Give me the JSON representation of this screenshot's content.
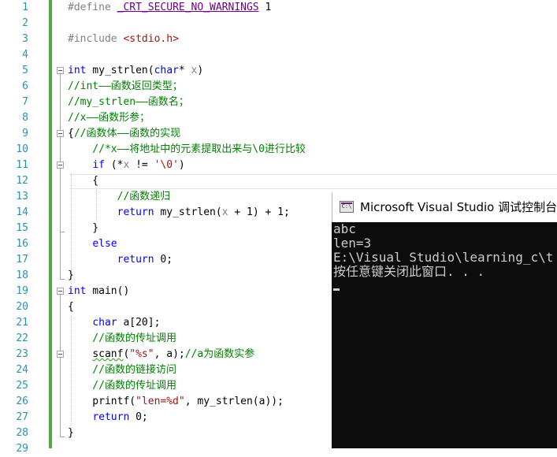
{
  "editor": {
    "line_numbers": [
      "1",
      "2",
      "3",
      "4",
      "5",
      "6",
      "7",
      "8",
      "9",
      "10",
      "11",
      "12",
      "13",
      "14",
      "15",
      "16",
      "17",
      "18",
      "19",
      "20",
      "21",
      "22",
      "23",
      "24",
      "25",
      "26",
      "27",
      "28",
      "29"
    ],
    "lines": [
      [
        {
          "t": "#define ",
          "c": "pp"
        },
        {
          "t": "_CRT_SECURE_NO_WARNINGS",
          "c": "mac",
          "u": "purple"
        },
        {
          "t": " 1",
          "c": "num"
        }
      ],
      [],
      [
        {
          "t": "#include ",
          "c": "pp"
        },
        {
          "t": "<stdio.h>",
          "c": "inc"
        }
      ],
      [],
      [
        {
          "t": "int",
          "c": "kw"
        },
        {
          "t": " my_strlen(",
          "c": ""
        },
        {
          "t": "char",
          "c": "kw"
        },
        {
          "t": "* ",
          "c": ""
        },
        {
          "t": "x",
          "c": "prm"
        },
        {
          "t": ")",
          "c": ""
        }
      ],
      [
        {
          "t": "//int——函数返回类型；",
          "c": "cm"
        }
      ],
      [
        {
          "t": "//my_strlen——函数名；",
          "c": "cm"
        }
      ],
      [
        {
          "t": "//x——函数形参；",
          "c": "cm"
        }
      ],
      [
        {
          "t": "{",
          "c": ""
        },
        {
          "t": "//函数体——函数的实现",
          "c": "cm"
        }
      ],
      [
        {
          "t": "    //*x——将地址中的元素提取出来与\\0进行比较",
          "c": "cm"
        }
      ],
      [
        {
          "t": "    ",
          "c": ""
        },
        {
          "t": "if",
          "c": "kw"
        },
        {
          "t": " (*",
          "c": ""
        },
        {
          "t": "x",
          "c": "prm"
        },
        {
          "t": " != ",
          "c": ""
        },
        {
          "t": "'\\0'",
          "c": "st"
        },
        {
          "t": ")",
          "c": ""
        }
      ],
      [
        {
          "t": "    {",
          "c": ""
        }
      ],
      [
        {
          "t": "        //函数递归",
          "c": "cm"
        }
      ],
      [
        {
          "t": "        ",
          "c": ""
        },
        {
          "t": "return",
          "c": "kw"
        },
        {
          "t": " my_strlen(",
          "c": ""
        },
        {
          "t": "x",
          "c": "prm"
        },
        {
          "t": " + 1) + 1;",
          "c": ""
        }
      ],
      [
        {
          "t": "    }",
          "c": ""
        }
      ],
      [
        {
          "t": "    ",
          "c": ""
        },
        {
          "t": "else",
          "c": "kw"
        }
      ],
      [
        {
          "t": "        ",
          "c": ""
        },
        {
          "t": "return",
          "c": "kw"
        },
        {
          "t": " 0;",
          "c": ""
        }
      ],
      [
        {
          "t": "}",
          "c": ""
        }
      ],
      [
        {
          "t": "int",
          "c": "kw"
        },
        {
          "t": " main()",
          "c": ""
        }
      ],
      [
        {
          "t": "{",
          "c": ""
        }
      ],
      [
        {
          "t": "    ",
          "c": ""
        },
        {
          "t": "char",
          "c": "kw"
        },
        {
          "t": " a[20];",
          "c": ""
        }
      ],
      [
        {
          "t": "    //函数的传址调用",
          "c": "cm"
        }
      ],
      [
        {
          "t": "    ",
          "c": ""
        },
        {
          "t": "scanf",
          "c": "sq"
        },
        {
          "t": "(",
          "c": ""
        },
        {
          "t": "\"%s\"",
          "c": "st"
        },
        {
          "t": ", a);",
          "c": ""
        },
        {
          "t": "//a为函数实参",
          "c": "cm"
        }
      ],
      [
        {
          "t": "    //函数的链接访问",
          "c": "cm"
        }
      ],
      [
        {
          "t": "    //函数的传址调用",
          "c": "cm"
        }
      ],
      [
        {
          "t": "    printf(",
          "c": ""
        },
        {
          "t": "\"len=%d\"",
          "c": "st"
        },
        {
          "t": ", my_strlen(a));",
          "c": ""
        }
      ],
      [
        {
          "t": "    ",
          "c": ""
        },
        {
          "t": "return",
          "c": "kw"
        },
        {
          "t": " 0;",
          "c": ""
        }
      ],
      [
        {
          "t": "}",
          "c": ""
        }
      ],
      []
    ]
  },
  "console": {
    "title": "Microsoft Visual Studio 调试控制台",
    "icon": "vs-console-icon",
    "output": [
      "abc",
      "len=3",
      "E:\\Visual Studio\\learning_c\\t",
      "按任意键关闭此窗口. . ."
    ]
  },
  "colors": {
    "line_number": "#2b91af",
    "keyword": "#0000ff",
    "comment": "#008000",
    "string": "#a31515",
    "change_bar": "#57a64a",
    "console_bg": "#0c0c0c",
    "console_text": "#cccccc"
  }
}
